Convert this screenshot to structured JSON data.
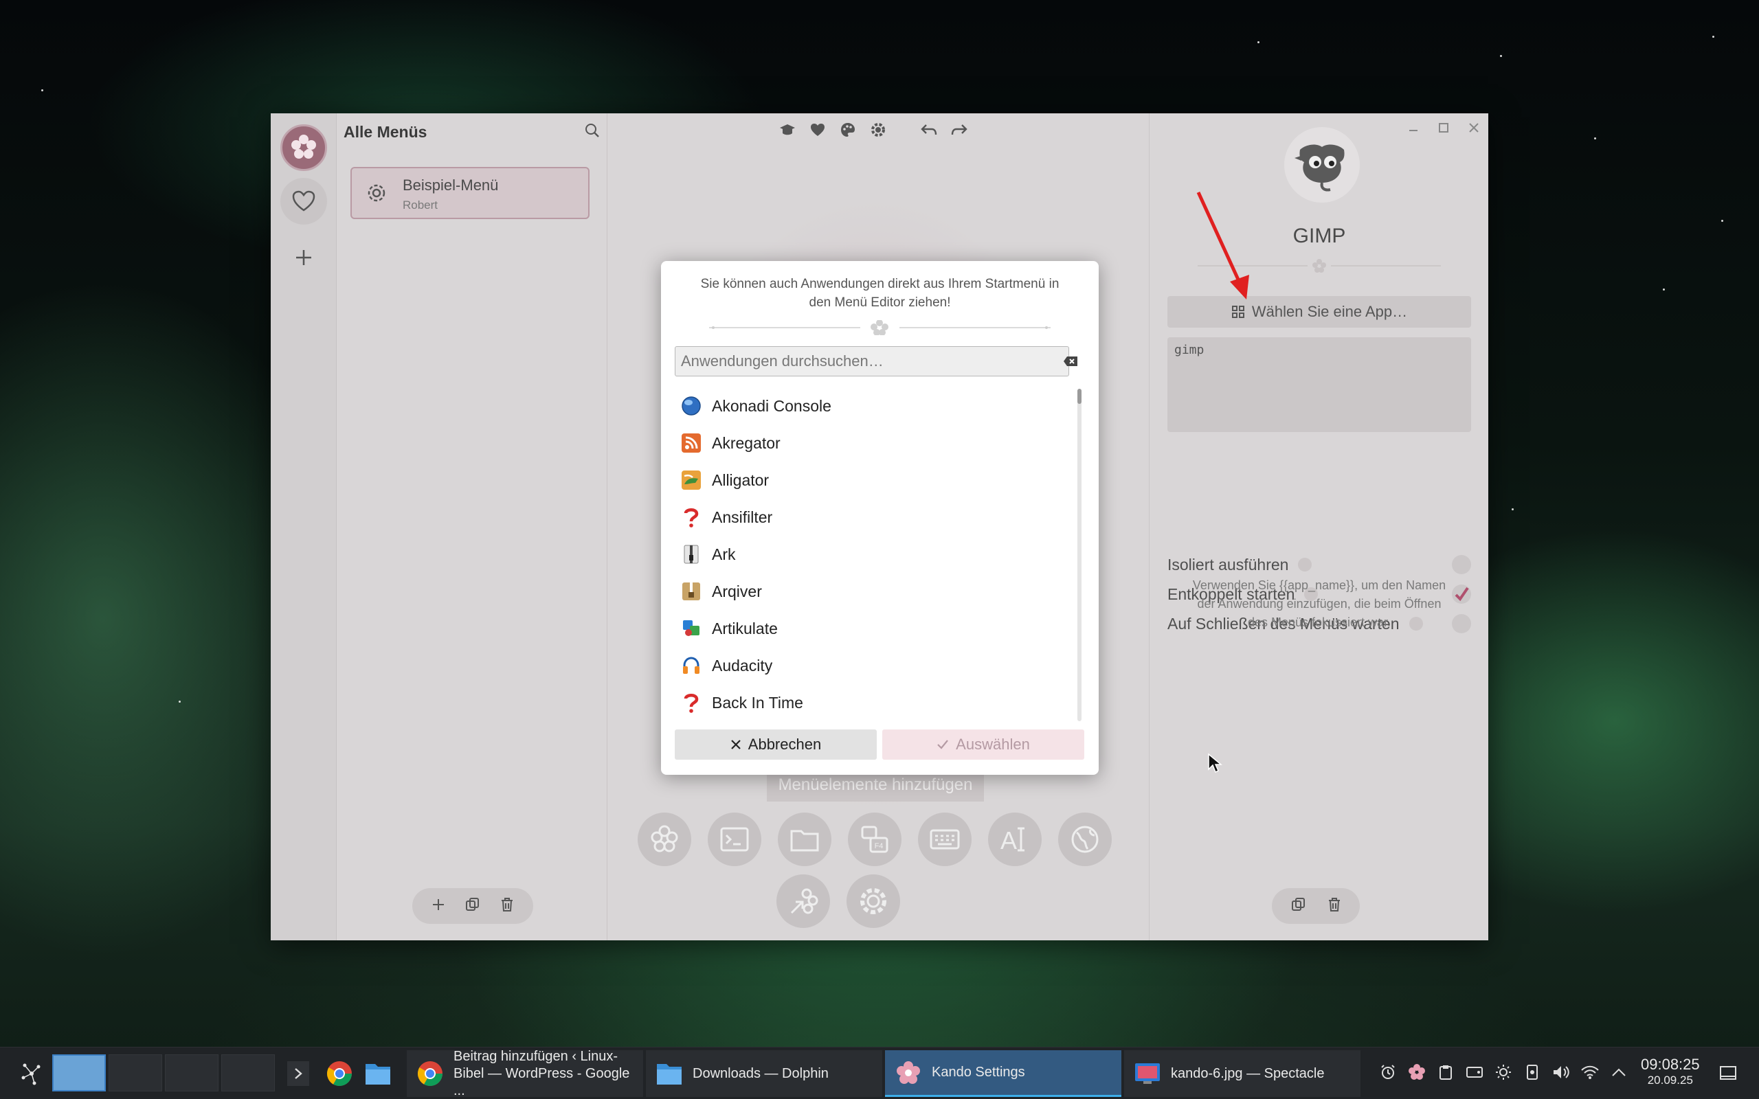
{
  "sidebar": {
    "title": "Alle Menüs",
    "menu_card": {
      "name": "Beispiel-Menü",
      "owner": "Robert"
    }
  },
  "editor": {
    "add_items_label": "Menüelemente hinzufügen"
  },
  "properties": {
    "app_name": "GIMP",
    "choose_app_label": "Wählen Sie eine App…",
    "command": "gimp",
    "options": [
      {
        "label": "Isoliert ausführen",
        "checked": false
      },
      {
        "label": "Entkoppelt starten",
        "checked": true
      },
      {
        "label": "Auf Schließen des Menüs warten",
        "checked": false
      }
    ],
    "hint": "Verwenden Sie {{app_name}}, um den Namen der Anwendung einzufügen, die beim Öffnen des Menüs fokussiert war."
  },
  "dialog": {
    "hint": "Sie können auch Anwendungen direkt aus Ihrem Startmenü in den Menü Editor ziehen!",
    "search_placeholder": "Anwendungen durchsuchen…",
    "apps": [
      {
        "label": "Akonadi Console",
        "icon": "globe-icon"
      },
      {
        "label": "Akregator",
        "icon": "rss-icon"
      },
      {
        "label": "Alligator",
        "icon": "alligator-icon"
      },
      {
        "label": "Ansifilter",
        "icon": "question-icon"
      },
      {
        "label": "Ark",
        "icon": "archive-icon"
      },
      {
        "label": "Arqiver",
        "icon": "archive-box-icon"
      },
      {
        "label": "Artikulate",
        "icon": "artikulate-icon"
      },
      {
        "label": "Audacity",
        "icon": "headphones-icon"
      },
      {
        "label": "Back In Time",
        "icon": "question-icon"
      }
    ],
    "cancel_label": "Abbrechen",
    "select_label": "Auswählen"
  },
  "taskbar": {
    "tasks": [
      {
        "label": "Beitrag hinzufügen ‹ Linux-\nBibel — WordPress - Google ...",
        "icon": "chrome-icon"
      },
      {
        "label": "Downloads — Dolphin",
        "icon": "folder-icon"
      },
      {
        "label": "Kando Settings",
        "icon": "kando-icon"
      },
      {
        "label": "kando-6.jpg — Spectacle",
        "icon": "spectacle-icon"
      }
    ],
    "clock_time": "09:08:25",
    "clock_date": "20.09.25"
  },
  "colors": {
    "accent": "#9a6a78",
    "check": "#b0506e",
    "taskbar_active": "#335a81",
    "annotation_arrow": "#e02020"
  }
}
